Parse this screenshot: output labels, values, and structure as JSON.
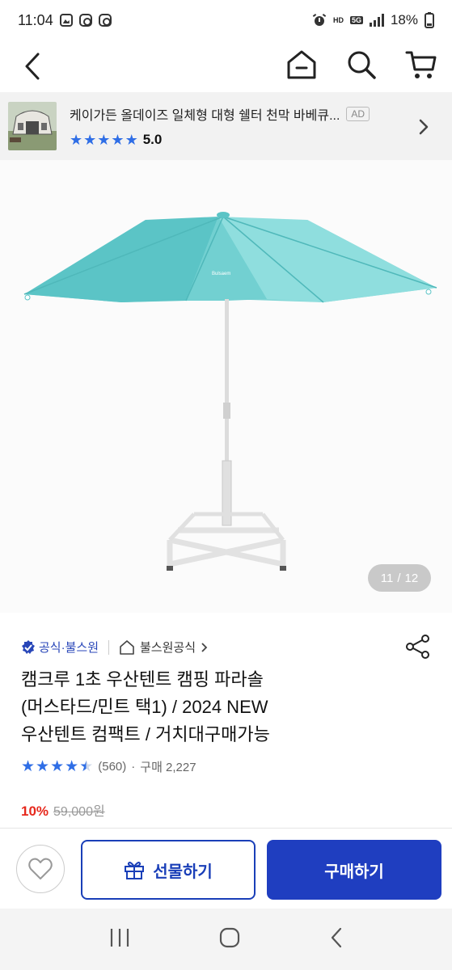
{
  "status": {
    "time": "11:04",
    "battery": "18%",
    "hd_label": "HD",
    "network": "5G"
  },
  "ad": {
    "title": "케이가든 올데이즈 일체형 대형 쉘터 천막 바베큐...",
    "badge": "AD",
    "score": "5.0",
    "stars": 5
  },
  "gallery": {
    "current": "11",
    "separator": "/",
    "total": "12",
    "umbrella_color": "#7dd3d3",
    "umbrella_logo": "Bulsaem"
  },
  "product": {
    "badge_label": "공식·불스원",
    "store_label": "불스원공식",
    "title_line1": "캠크루 1초 우산텐트 캠핑 파라솔",
    "title_line2": "(머스타드/민트 택1) / 2024 NEW",
    "title_line3": "우산텐트 컴팩트 / 거치대구매가능",
    "rating": 4.5,
    "review_count": "(560)",
    "separator_dot": "·",
    "purchase_label": "구매 2,227",
    "discount": "10%",
    "original_price": "59,000원"
  },
  "actions": {
    "gift_label": "선물하기",
    "buy_label": "구매하기"
  },
  "colors": {
    "accent": "#1f3ec0",
    "star": "#2f6ee6",
    "discount": "#e6281c"
  }
}
